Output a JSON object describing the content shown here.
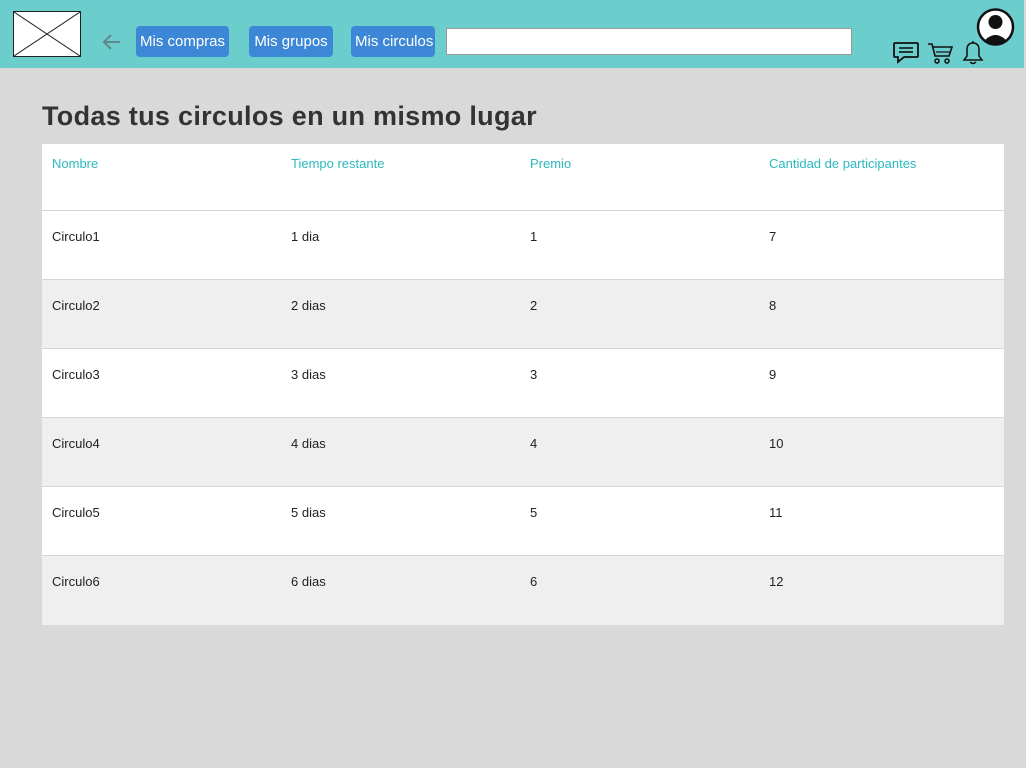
{
  "header": {
    "nav": [
      "Mis compras",
      "Mis grupos",
      "Mis circulos"
    ],
    "search_value": "",
    "icons": [
      "logo-placeholder",
      "back-arrow-icon",
      "chat-icon",
      "cart-icon",
      "bell-icon",
      "user-avatar-icon"
    ]
  },
  "colors": {
    "topbar": "#6ccdcd",
    "nav_button": "#3d88d6",
    "header_text": "#2bb8bf",
    "background": "#d9d9d9",
    "stripe": "#efefef"
  },
  "main": {
    "title": "Todas tus circulos en un mismo lugar",
    "table": {
      "columns": [
        "Nombre",
        "Tiempo restante",
        "Premio",
        "Cantidad de participantes"
      ],
      "rows": [
        [
          "Circulo1",
          "1 dia",
          "1",
          "7"
        ],
        [
          "Circulo2",
          "2 dias",
          "2",
          "8"
        ],
        [
          "Circulo3",
          "3 dias",
          "3",
          "9"
        ],
        [
          "Circulo4",
          "4 dias",
          "4",
          "10"
        ],
        [
          "Circulo5",
          "5 dias",
          "5",
          "11"
        ],
        [
          "Circulo6",
          "6 dias",
          "6",
          "12"
        ]
      ]
    }
  }
}
